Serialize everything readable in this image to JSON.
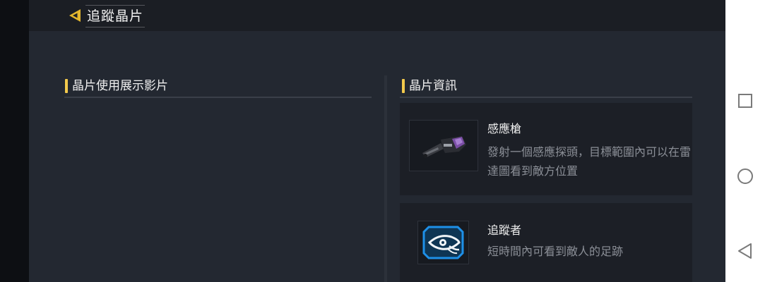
{
  "header": {
    "title": "追蹤晶片"
  },
  "left_panel": {
    "title": "晶片使用展示影片"
  },
  "right_panel": {
    "title": "晶片資訊",
    "items": [
      {
        "name": "感應槍",
        "description": "發射一個感應探頭，目標範圍內可以在雷達圖看到敵方位置",
        "icon": "sensor-gun-icon"
      },
      {
        "name": "追蹤者",
        "description": "短時間內可看到敵人的足跡",
        "icon": "tracker-eye-icon"
      }
    ]
  },
  "system_nav": {
    "buttons": [
      "recents-square-icon",
      "home-circle-icon",
      "back-triangle-icon"
    ]
  },
  "colors": {
    "accent": "#f2c94c",
    "tracker_blue": "#1e90e8",
    "background": "#232831",
    "card": "#1c1f26"
  }
}
